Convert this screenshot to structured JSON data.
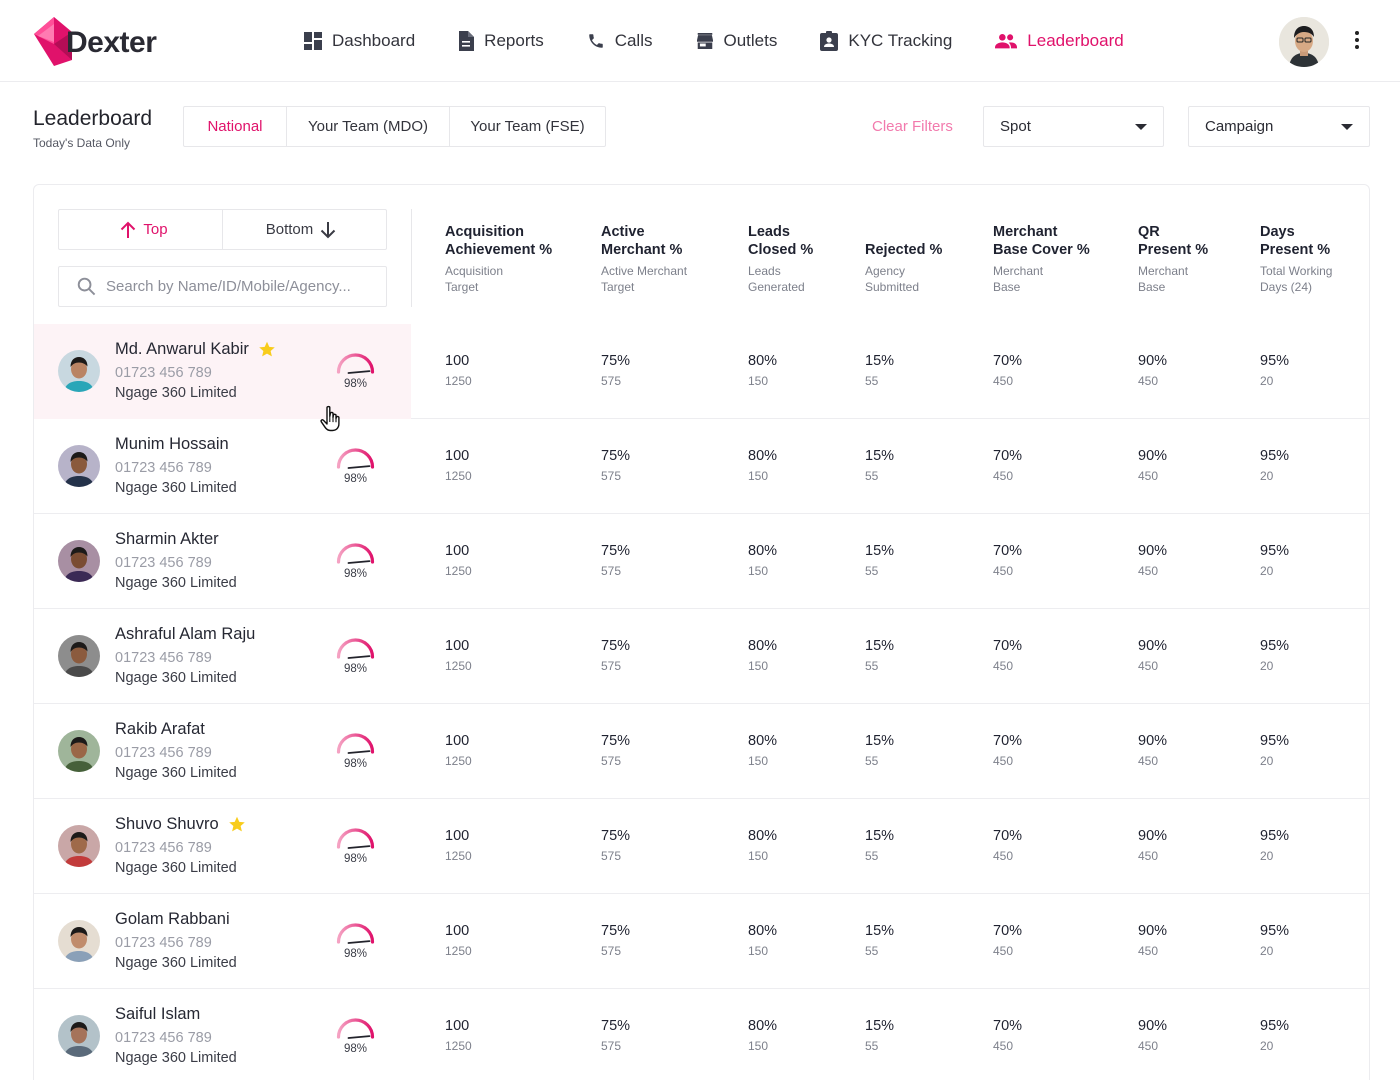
{
  "app": {
    "logo_text": "Dexter",
    "brand_color": "#e0126b"
  },
  "nav": [
    {
      "label": "Dashboard",
      "icon": "dashboard-icon",
      "active": false
    },
    {
      "label": "Reports",
      "icon": "report-icon",
      "active": false
    },
    {
      "label": "Calls",
      "icon": "phone-icon",
      "active": false
    },
    {
      "label": "Outlets",
      "icon": "store-icon",
      "active": false
    },
    {
      "label": "KYC Tracking",
      "icon": "id-badge-icon",
      "active": false
    },
    {
      "label": "Leaderboard",
      "icon": "people-icon",
      "active": true
    }
  ],
  "header": {
    "title": "Leaderboard",
    "subtitle": "Today's Data Only",
    "scope_tabs": [
      {
        "label": "National",
        "active": true
      },
      {
        "label": "Your Team (MDO)",
        "active": false
      },
      {
        "label": "Your Team (FSE)",
        "active": false
      }
    ],
    "clear_filters": "Clear Filters",
    "spot_select": "Spot",
    "campaign_select": "Campaign"
  },
  "panel": {
    "top_label": "Top",
    "bottom_label": "Bottom",
    "search_placeholder": "Search by Name/ID/Mobile/Agency..."
  },
  "columns": [
    {
      "title": "Acquisition\nAchievement %",
      "sub": "Acquisition\nTarget"
    },
    {
      "title": "Active\nMerchant %",
      "sub": "Active Merchant\nTarget"
    },
    {
      "title": "Leads\nClosed %",
      "sub": "Leads\nGenerated"
    },
    {
      "title": "Rejected %",
      "sub": "Agency\nSubmitted"
    },
    {
      "title": "Merchant\nBase Cover %",
      "sub": "Merchant\nBase"
    },
    {
      "title": "QR\nPresent %",
      "sub": "Merchant\nBase"
    },
    {
      "title": "Days\nPresent %",
      "sub": "Total Working\nDays (24)"
    }
  ],
  "rows": [
    {
      "name": "Md. Anwarul Kabir",
      "star": true,
      "highlight": true,
      "phone": "01723 456 789",
      "agency": "Ngage 360 Limited",
      "score": "98%",
      "score_value": 0.98,
      "avatar": "avatar-photo",
      "cells": [
        [
          "100",
          "1250"
        ],
        [
          "75%",
          "575"
        ],
        [
          "80%",
          "150"
        ],
        [
          "15%",
          "55"
        ],
        [
          "70%",
          "450"
        ],
        [
          "90%",
          "450"
        ],
        [
          "95%",
          "20"
        ]
      ]
    },
    {
      "name": "Munim Hossain",
      "star": false,
      "highlight": false,
      "phone": "01723 456 789",
      "agency": "Ngage 360 Limited",
      "score": "98%",
      "score_value": 0.98,
      "avatar": "avatar-photo",
      "cells": [
        [
          "100",
          "1250"
        ],
        [
          "75%",
          "575"
        ],
        [
          "80%",
          "150"
        ],
        [
          "15%",
          "55"
        ],
        [
          "70%",
          "450"
        ],
        [
          "90%",
          "450"
        ],
        [
          "95%",
          "20"
        ]
      ]
    },
    {
      "name": "Sharmin Akter",
      "star": false,
      "highlight": false,
      "phone": "01723 456 789",
      "agency": "Ngage 360 Limited",
      "score": "98%",
      "score_value": 0.98,
      "avatar": "avatar-photo",
      "cells": [
        [
          "100",
          "1250"
        ],
        [
          "75%",
          "575"
        ],
        [
          "80%",
          "150"
        ],
        [
          "15%",
          "55"
        ],
        [
          "70%",
          "450"
        ],
        [
          "90%",
          "450"
        ],
        [
          "95%",
          "20"
        ]
      ]
    },
    {
      "name": "Ashraful Alam Raju",
      "star": false,
      "highlight": false,
      "phone": "01723 456 789",
      "agency": "Ngage 360 Limited",
      "score": "98%",
      "score_value": 0.98,
      "avatar": "avatar-photo",
      "cells": [
        [
          "100",
          "1250"
        ],
        [
          "75%",
          "575"
        ],
        [
          "80%",
          "150"
        ],
        [
          "15%",
          "55"
        ],
        [
          "70%",
          "450"
        ],
        [
          "90%",
          "450"
        ],
        [
          "95%",
          "20"
        ]
      ]
    },
    {
      "name": "Rakib Arafat",
      "star": false,
      "highlight": false,
      "phone": "01723 456 789",
      "agency": "Ngage 360 Limited",
      "score": "98%",
      "score_value": 0.98,
      "avatar": "avatar-photo",
      "cells": [
        [
          "100",
          "1250"
        ],
        [
          "75%",
          "575"
        ],
        [
          "80%",
          "150"
        ],
        [
          "15%",
          "55"
        ],
        [
          "70%",
          "450"
        ],
        [
          "90%",
          "450"
        ],
        [
          "95%",
          "20"
        ]
      ]
    },
    {
      "name": "Shuvo Shuvro",
      "star": true,
      "highlight": false,
      "phone": "01723 456 789",
      "agency": "Ngage 360 Limited",
      "score": "98%",
      "score_value": 0.98,
      "avatar": "avatar-photo",
      "cells": [
        [
          "100",
          "1250"
        ],
        [
          "75%",
          "575"
        ],
        [
          "80%",
          "150"
        ],
        [
          "15%",
          "55"
        ],
        [
          "70%",
          "450"
        ],
        [
          "90%",
          "450"
        ],
        [
          "95%",
          "20"
        ]
      ]
    },
    {
      "name": "Golam Rabbani",
      "star": false,
      "highlight": false,
      "phone": "01723 456 789",
      "agency": "Ngage 360 Limited",
      "score": "98%",
      "score_value": 0.98,
      "avatar": "avatar-photo",
      "cells": [
        [
          "100",
          "1250"
        ],
        [
          "75%",
          "575"
        ],
        [
          "80%",
          "150"
        ],
        [
          "15%",
          "55"
        ],
        [
          "70%",
          "450"
        ],
        [
          "90%",
          "450"
        ],
        [
          "95%",
          "20"
        ]
      ]
    },
    {
      "name": "Saiful Islam",
      "star": false,
      "highlight": false,
      "phone": "01723 456 789",
      "agency": "Ngage 360 Limited",
      "score": "98%",
      "score_value": 0.98,
      "avatar": "avatar-photo",
      "cells": [
        [
          "100",
          "1250"
        ],
        [
          "75%",
          "575"
        ],
        [
          "80%",
          "150"
        ],
        [
          "15%",
          "55"
        ],
        [
          "70%",
          "450"
        ],
        [
          "90%",
          "450"
        ],
        [
          "95%",
          "20"
        ]
      ]
    }
  ]
}
